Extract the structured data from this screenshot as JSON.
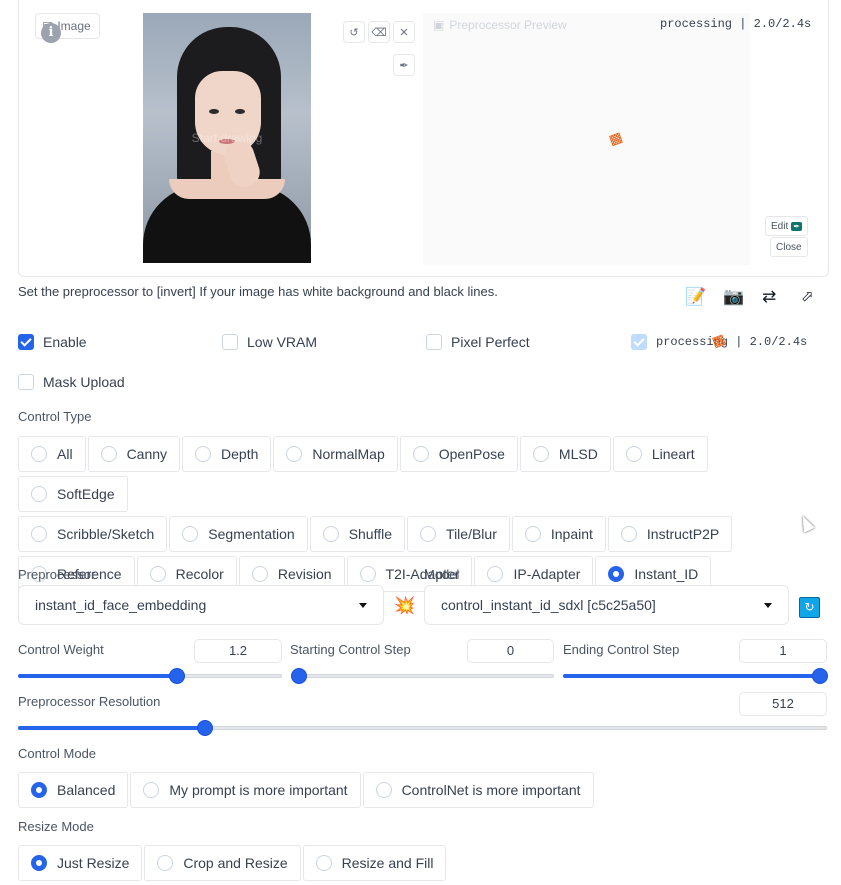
{
  "image_panel": {
    "tab_label": "Image",
    "overlay_text": "Start drawing",
    "preview_label": "Preprocessor Preview",
    "status": "processing | 2.0/2.4s",
    "edit_label": "Edit",
    "close_label": "Close"
  },
  "hint": "Set the preprocessor to [invert] If your image has white background and black lines.",
  "checkboxes": {
    "enable": {
      "label": "Enable",
      "checked": true
    },
    "low_vram": {
      "label": "Low VRAM",
      "checked": false
    },
    "pixel_perfect": {
      "label": "Pixel Perfect",
      "checked": false
    },
    "allow_preview_status": "processing | 2.0/2.4s",
    "mask_upload": {
      "label": "Mask Upload",
      "checked": false
    }
  },
  "control_type": {
    "label": "Control Type",
    "options": [
      "All",
      "Canny",
      "Depth",
      "NormalMap",
      "OpenPose",
      "MLSD",
      "Lineart",
      "SoftEdge",
      "Scribble/Sketch",
      "Segmentation",
      "Shuffle",
      "Tile/Blur",
      "Inpaint",
      "InstructP2P",
      "Reference",
      "Recolor",
      "Revision",
      "T2I-Adapter",
      "IP-Adapter",
      "Instant_ID"
    ],
    "selected": "Instant_ID"
  },
  "preprocessor": {
    "label": "Preprocessor",
    "value": "instant_id_face_embedding"
  },
  "model": {
    "label": "Model",
    "value": "control_instant_id_sdxl [c5c25a50]"
  },
  "control_weight": {
    "label": "Control Weight",
    "value": "1.2",
    "fraction": 0.6
  },
  "starting_step": {
    "label": "Starting Control Step",
    "value": "0",
    "fraction": 0.0
  },
  "ending_step": {
    "label": "Ending Control Step",
    "value": "1",
    "fraction": 1.0
  },
  "resolution": {
    "label": "Preprocessor Resolution",
    "value": "512",
    "fraction": 0.23
  },
  "control_mode": {
    "label": "Control Mode",
    "options": [
      "Balanced",
      "My prompt is more important",
      "ControlNet is more important"
    ],
    "selected": "Balanced"
  },
  "resize_mode": {
    "label": "Resize Mode",
    "options": [
      "Just Resize",
      "Crop and Resize",
      "Resize and Fill"
    ],
    "selected": "Just Resize"
  },
  "colors": {
    "accent": "#2563eb",
    "warning": "#ea580c"
  }
}
